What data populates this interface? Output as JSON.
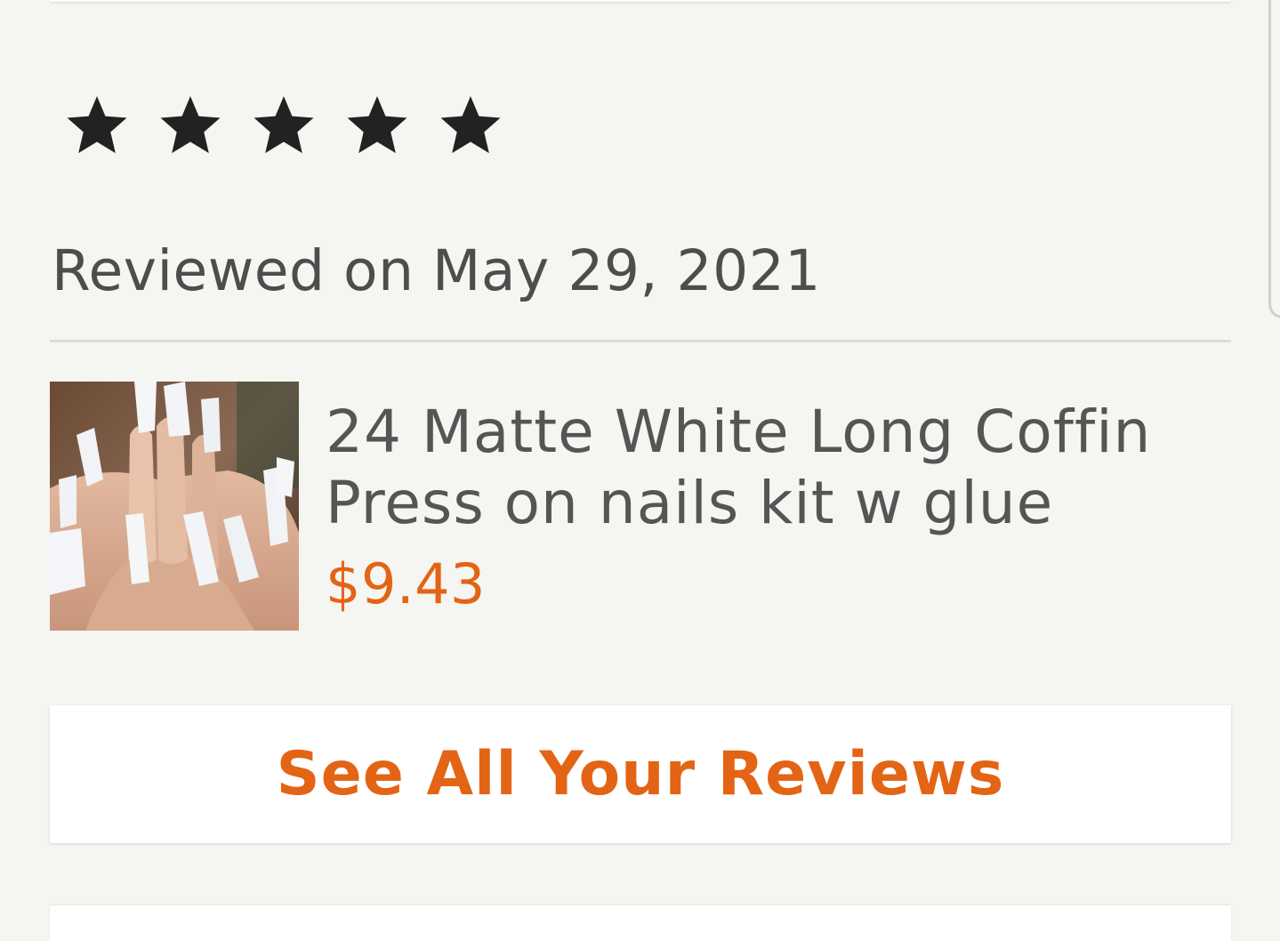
{
  "review": {
    "rating": 5,
    "rating_max": 5,
    "star_color": "#222222",
    "date_text": "Reviewed on May 29, 2021"
  },
  "product": {
    "image_icon": "product-thumbnail",
    "title": "24 Matte White Long Coffin Press on nails kit w glue",
    "price": "$9.43",
    "price_color": "#e36414"
  },
  "actions": {
    "see_all_label": "See All Your Reviews",
    "accent_color": "#e36414"
  }
}
